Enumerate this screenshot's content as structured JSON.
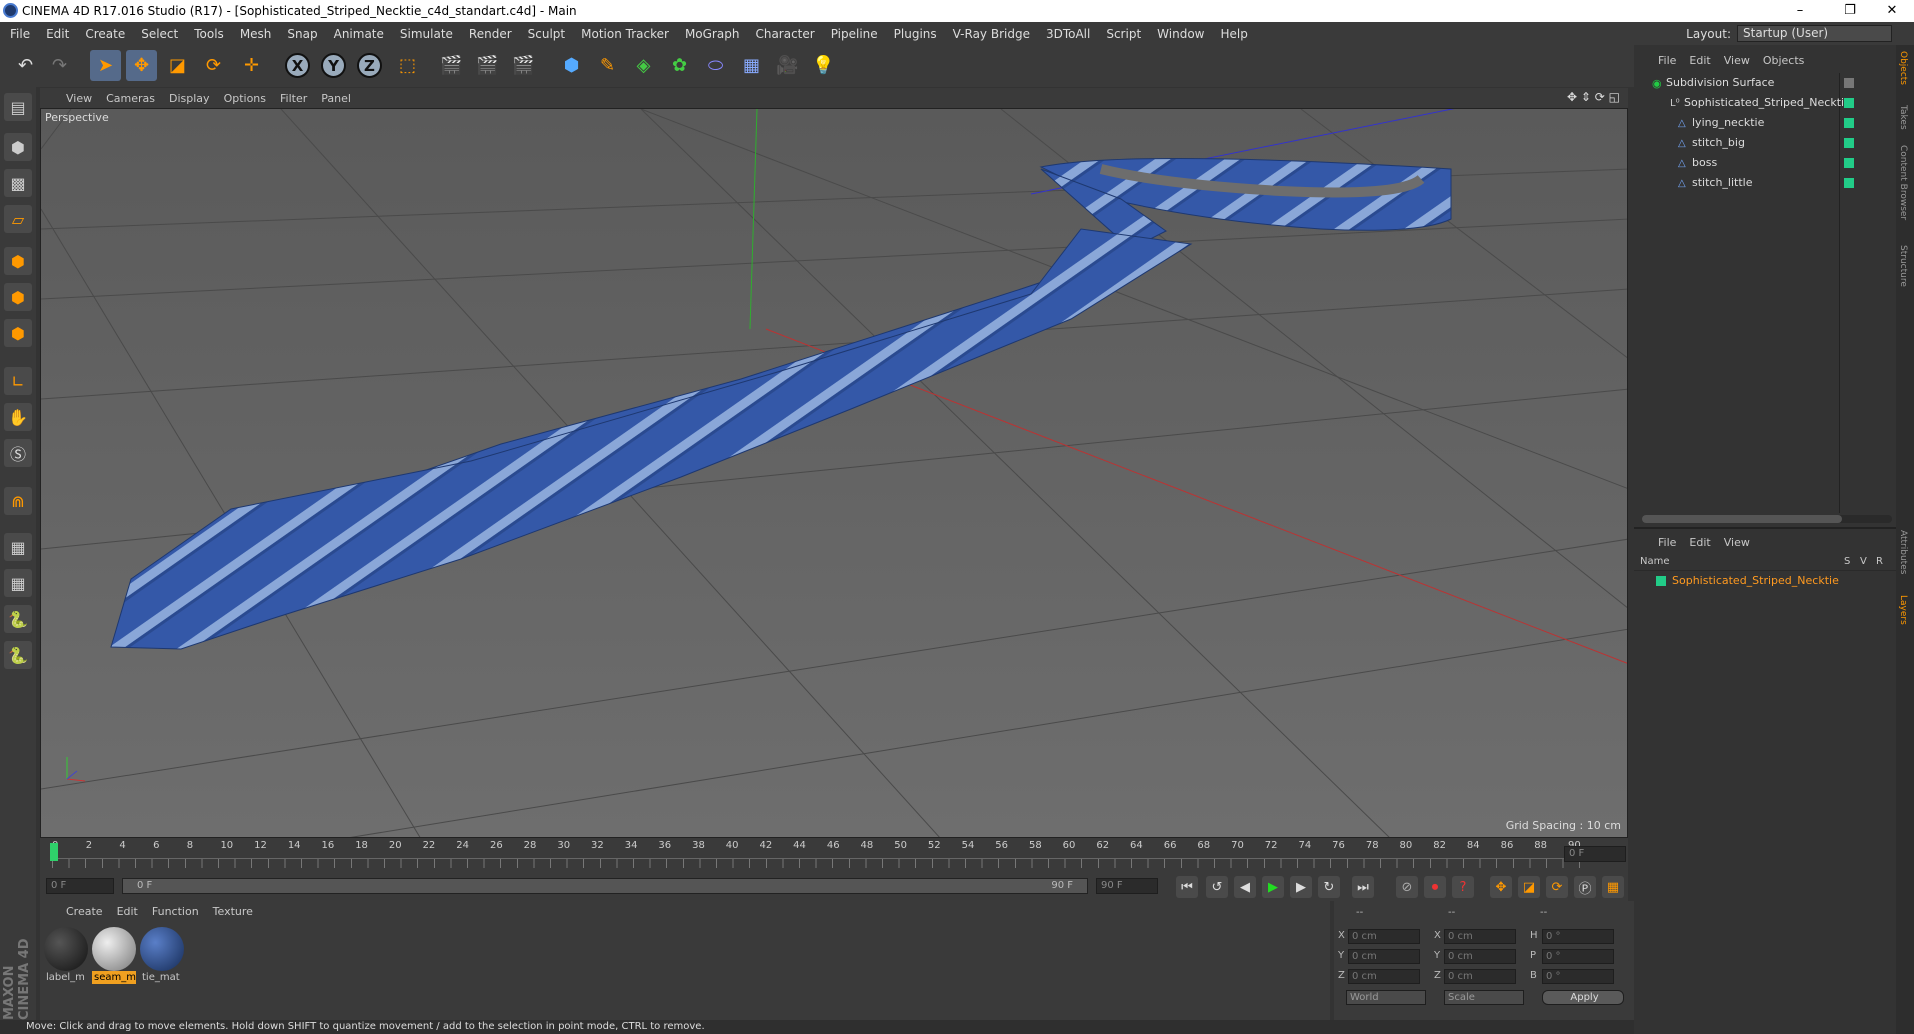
{
  "window": {
    "title": "CINEMA 4D R17.016 Studio (R17) - [Sophisticated_Striped_Necktie_c4d_standart.c4d] - Main",
    "controls": [
      "–",
      "❐",
      "✕"
    ]
  },
  "menubar": {
    "items": [
      "File",
      "Edit",
      "Create",
      "Select",
      "Tools",
      "Mesh",
      "Snap",
      "Animate",
      "Simulate",
      "Render",
      "Sculpt",
      "Motion Tracker",
      "MoGraph",
      "Character",
      "Pipeline",
      "Plugins",
      "V-Ray Bridge",
      "3DToAll",
      "Script",
      "Window",
      "Help"
    ],
    "layout_label": "Layout:",
    "layout_value": "Startup (User)"
  },
  "toolbar": {
    "axis_x": "X",
    "axis_y": "Y",
    "axis_z": "Z"
  },
  "viewport": {
    "menu": [
      "View",
      "Cameras",
      "Display",
      "Options",
      "Filter",
      "Panel"
    ],
    "label": "Perspective",
    "grid_spacing": "Grid Spacing : 10 cm"
  },
  "timeline": {
    "ticks": [
      "0",
      "2",
      "4",
      "6",
      "8",
      "10",
      "12",
      "14",
      "16",
      "18",
      "20",
      "22",
      "24",
      "26",
      "28",
      "30",
      "32",
      "34",
      "36",
      "38",
      "40",
      "42",
      "44",
      "46",
      "48",
      "50",
      "52",
      "54",
      "56",
      "58",
      "60",
      "62",
      "64",
      "66",
      "68",
      "70",
      "72",
      "74",
      "76",
      "78",
      "80",
      "82",
      "84",
      "86",
      "88",
      "90"
    ],
    "current_frame": "0 F",
    "start_frame": "0 F",
    "range_start": "0 F",
    "range_end": "90 F",
    "end_frame": "90 F"
  },
  "material_manager": {
    "menu": [
      "Create",
      "Edit",
      "Function",
      "Texture"
    ],
    "materials": [
      {
        "name": "label_m",
        "color": "#2a2a2a"
      },
      {
        "name": "seam_m",
        "color": "#bfbfbf"
      },
      {
        "name": "tie_mat",
        "color": "#2c4f8a"
      }
    ]
  },
  "coordinates": {
    "header": [
      "--",
      "--",
      "--"
    ],
    "rows": [
      {
        "a": "X",
        "av": "0 cm",
        "b": "X",
        "bv": "0 cm",
        "c": "H",
        "cv": "0 °"
      },
      {
        "a": "Y",
        "av": "0 cm",
        "b": "Y",
        "bv": "0 cm",
        "c": "P",
        "cv": "0 °"
      },
      {
        "a": "Z",
        "av": "0 cm",
        "b": "Z",
        "bv": "0 cm",
        "c": "B",
        "cv": "0 °"
      }
    ],
    "mode": "World",
    "scale": "Scale",
    "apply": "Apply"
  },
  "status": {
    "text": "Move: Click and drag to move elements. Hold down SHIFT to quantize movement / add to the selection in point mode, CTRL to remove."
  },
  "objects_panel": {
    "menu": [
      "File",
      "Edit",
      "View",
      "Objects"
    ],
    "items": [
      {
        "name": "Subdivision Surface",
        "indent": 0
      },
      {
        "name": "Sophisticated_Striped_Necktie",
        "indent": 1
      },
      {
        "name": "lying_necktie",
        "indent": 2
      },
      {
        "name": "stitch_big",
        "indent": 2
      },
      {
        "name": "boss",
        "indent": 2
      },
      {
        "name": "stitch_little",
        "indent": 2
      }
    ]
  },
  "layers_panel": {
    "menu": [
      "File",
      "Edit",
      "View"
    ],
    "header_name": "Name",
    "header_cols": [
      "S",
      "V",
      "R"
    ],
    "layer": "Sophisticated_Striped_Necktie"
  },
  "side_tabs": [
    "Objects",
    "Takes",
    "Content Browser",
    "Structure",
    "Attributes",
    "Layers"
  ],
  "brand": "MAXON CINEMA 4D"
}
